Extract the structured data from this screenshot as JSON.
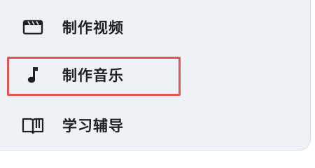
{
  "menu": {
    "items": [
      {
        "label": "制作视频",
        "icon": "clapperboard-icon"
      },
      {
        "label": "制作音乐",
        "icon": "music-note-icon",
        "highlighted": true
      },
      {
        "label": "学习辅导",
        "icon": "open-book-icon"
      }
    ]
  },
  "colors": {
    "panel_background": "#eef2f7",
    "text": "#202124",
    "highlight_border": "#e25555"
  }
}
